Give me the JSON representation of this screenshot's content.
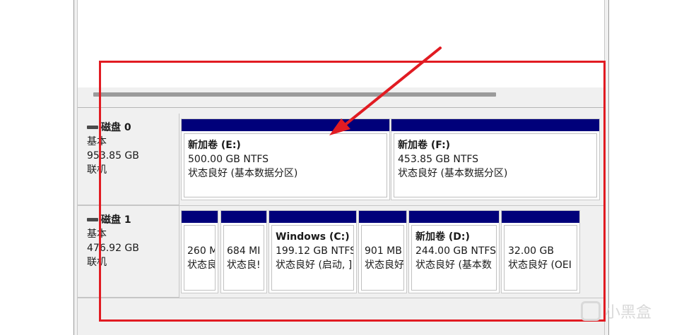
{
  "disks": [
    {
      "name": "磁盘 0",
      "type": "基本",
      "size": "953.85 GB",
      "status": "联机",
      "partitions": [
        {
          "title": "新加卷 (E:)",
          "size": "500.00 GB NTFS",
          "status": "状态良好 (基本数据分区)"
        },
        {
          "title": "新加卷 (F:)",
          "size": "453.85 GB NTFS",
          "status": "状态良好 (基本数据分区)"
        }
      ]
    },
    {
      "name": "磁盘 1",
      "type": "基本",
      "size": "476.92 GB",
      "status": "联机",
      "partitions": [
        {
          "title": "",
          "size": "260 M",
          "status": "状态良"
        },
        {
          "title": "",
          "size": "684 MI",
          "status": "状态良!"
        },
        {
          "title": "Windows  (C:)",
          "size": "199.12 GB NTFS",
          "status": "状态良好 (启动, ]"
        },
        {
          "title": "",
          "size": "901 MB",
          "status": "状态良好"
        },
        {
          "title": "新加卷  (D:)",
          "size": "244.00 GB NTFS",
          "status": "状态良好 (基本数"
        },
        {
          "title": "",
          "size": "32.00 GB",
          "status": "状态良好 (OEI"
        }
      ]
    }
  ],
  "watermark": "小黑盒",
  "colors": {
    "partition_bar": "#00007a",
    "highlight": "#e11b22"
  }
}
